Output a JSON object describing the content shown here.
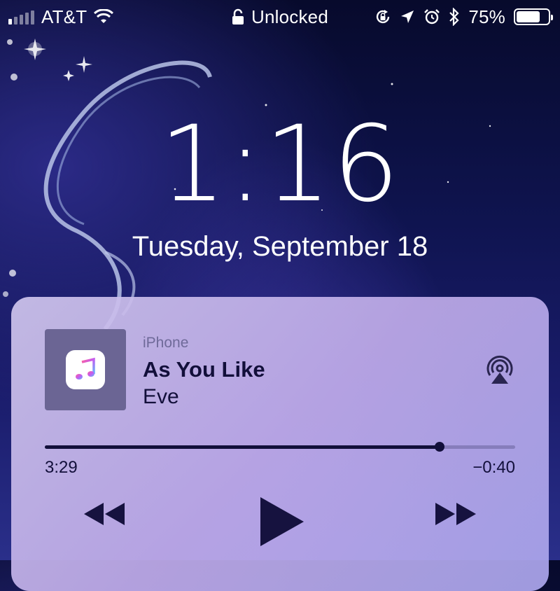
{
  "status_bar": {
    "carrier": "AT&T",
    "lock_status": "Unlocked",
    "battery_percent": "75%",
    "battery_level": 0.75,
    "signal_bars_filled": 1,
    "signal_bars_total": 5,
    "icons": [
      "wifi-icon",
      "padlock-icon",
      "rotation-lock-icon",
      "location-arrow-icon",
      "alarm-icon",
      "bluetooth-icon",
      "battery-icon"
    ]
  },
  "lockscreen": {
    "time": "1:16",
    "date": "Tuesday, September 18"
  },
  "now_playing": {
    "device": "iPhone",
    "title": "As You Like",
    "artist": "Eve",
    "elapsed": "3:29",
    "remaining": "−0:40",
    "progress": 0.84,
    "controls": [
      "rewind-icon",
      "play-icon",
      "fast-forward-icon"
    ],
    "airplay_icon": "airplay-icon",
    "app_icon": "apple-music-icon"
  },
  "colors": {
    "card_text": "#120f3a",
    "secondary_text": "#6f6a99",
    "artwork_bg": "#6b6594"
  }
}
